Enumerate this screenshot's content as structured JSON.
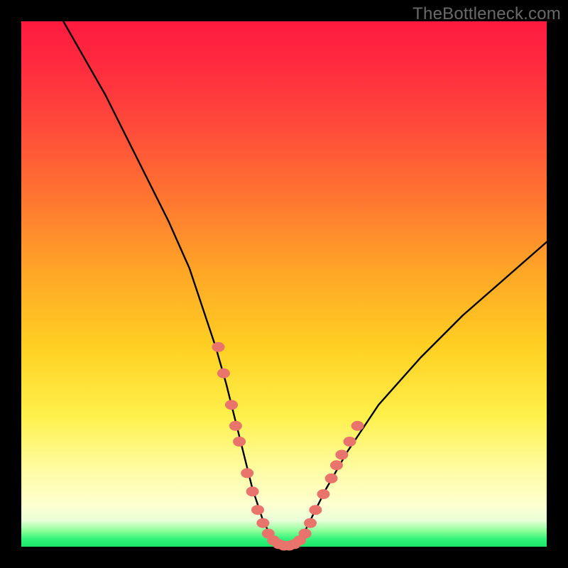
{
  "watermark": "TheBottleneck.com",
  "chart_data": {
    "type": "line",
    "title": "",
    "xlabel": "",
    "ylabel": "",
    "xlim": [
      0,
      100
    ],
    "ylim": [
      0,
      100
    ],
    "grid": false,
    "legend": false,
    "series": [
      {
        "name": "bottleneck-curve",
        "x": [
          8,
          12,
          16,
          20,
          24,
          28,
          32,
          35,
          37,
          39,
          40,
          41,
          42,
          43,
          44,
          45,
          46,
          47,
          48,
          49,
          50,
          51,
          52,
          53,
          54,
          55,
          56,
          58,
          62,
          68,
          76,
          84,
          92,
          100
        ],
        "y": [
          100,
          93,
          86,
          78,
          70,
          62,
          53,
          44,
          38,
          31,
          27,
          23,
          19,
          15,
          11,
          8,
          5,
          3,
          1.5,
          0.6,
          0.2,
          0.2,
          0.6,
          1.5,
          3,
          5,
          7,
          11,
          18,
          27,
          36,
          44,
          51,
          58
        ]
      }
    ],
    "markers": {
      "name": "highlight-dots",
      "color": "#e9746b",
      "points": [
        {
          "x": 37.5,
          "y": 38
        },
        {
          "x": 38.5,
          "y": 33
        },
        {
          "x": 40,
          "y": 27
        },
        {
          "x": 40.8,
          "y": 23
        },
        {
          "x": 41.5,
          "y": 20
        },
        {
          "x": 43,
          "y": 14
        },
        {
          "x": 44,
          "y": 10.5
        },
        {
          "x": 45,
          "y": 7
        },
        {
          "x": 46,
          "y": 4.5
        },
        {
          "x": 47,
          "y": 2.5
        },
        {
          "x": 48,
          "y": 1.2
        },
        {
          "x": 49,
          "y": 0.5
        },
        {
          "x": 50,
          "y": 0.2
        },
        {
          "x": 51,
          "y": 0.2
        },
        {
          "x": 52,
          "y": 0.5
        },
        {
          "x": 53,
          "y": 1.2
        },
        {
          "x": 54,
          "y": 2.5
        },
        {
          "x": 55,
          "y": 4.5
        },
        {
          "x": 56,
          "y": 7
        },
        {
          "x": 57.5,
          "y": 10
        },
        {
          "x": 59,
          "y": 13
        },
        {
          "x": 60,
          "y": 15.5
        },
        {
          "x": 61,
          "y": 17.5
        },
        {
          "x": 62.5,
          "y": 20
        },
        {
          "x": 64,
          "y": 23
        }
      ]
    }
  }
}
